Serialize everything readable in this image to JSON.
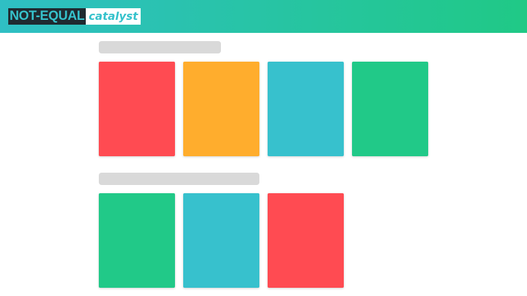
{
  "header": {
    "logo_primary": "NOT-EQUAL",
    "logo_secondary": "catalyst",
    "gradient_start": "#2fbfc4",
    "gradient_end": "#20c986"
  },
  "sections": [
    {
      "heading_placeholder": true,
      "tiles": [
        {
          "color": "#ff4b52"
        },
        {
          "color": "#ffad2d"
        },
        {
          "color": "#37c1cd"
        },
        {
          "color": "#21c988"
        }
      ]
    },
    {
      "heading_placeholder": true,
      "tiles": [
        {
          "color": "#21c988"
        },
        {
          "color": "#37c1cd"
        },
        {
          "color": "#ff4b52"
        }
      ]
    }
  ]
}
